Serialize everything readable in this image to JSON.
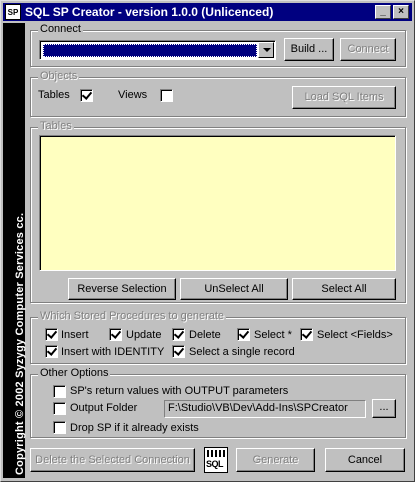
{
  "window": {
    "title": "SQL SP Creator - version 1.0.0 (Unlicenced)",
    "icon_text": "SP",
    "minimize_icon": "_",
    "close_icon": "×"
  },
  "sidebar": {
    "copyright": "Copyright © 2002 Syzygy Computer Services cc."
  },
  "connect": {
    "legend": "Connect",
    "combo_value": "",
    "build_label": "Build ...",
    "connect_label": "Connect"
  },
  "objects": {
    "legend": "Objects",
    "tables_label": "Tables",
    "tables_checked": true,
    "views_label": "Views",
    "views_checked": false,
    "load_label": "Load SQL Items"
  },
  "tables": {
    "legend": "Tables",
    "items": [],
    "reverse_label": "Reverse Selection",
    "unselect_label": "UnSelect All",
    "select_all_label": "Select All"
  },
  "procedures": {
    "legend": "Which Stored Procedures to generate",
    "insert_label": "Insert",
    "update_label": "Update",
    "delete_label": "Delete",
    "select_star_label": "Select *",
    "select_fields_label": "Select <Fields>",
    "insert_identity_label": "Insert with IDENTITY",
    "select_single_label": "Select a single record"
  },
  "other": {
    "legend": "Other Options",
    "output_params_label": "SP's return values with OUTPUT parameters",
    "output_folder_label": "Output Folder",
    "output_folder_value": "F:\\Studio\\VB\\Dev\\Add-Ins\\SPCreator",
    "browse_label": "...",
    "drop_label": "Drop SP if it already exists"
  },
  "footer": {
    "delete_label": "Delete the Selected Connection",
    "sql_icon_text": "SQL",
    "generate_label": "Generate",
    "cancel_label": "Cancel"
  }
}
